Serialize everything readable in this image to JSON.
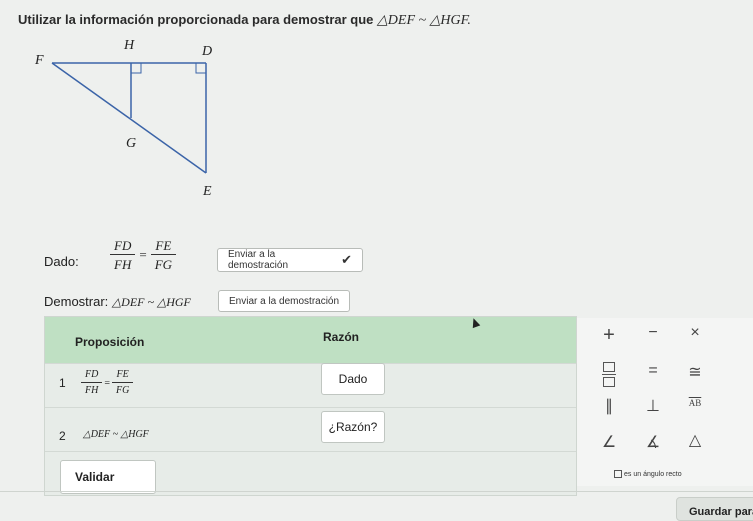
{
  "instruction": {
    "prefix": "Utilizar la información proporcionada para demostrar que",
    "expression": "△DEF ~ △HGF."
  },
  "diagram": {
    "labels": {
      "H": "H",
      "D": "D",
      "F": "F",
      "G": "G",
      "E": "E"
    }
  },
  "given": {
    "label": "Dado:",
    "left_num": "FD",
    "left_den": "FH",
    "equals": "=",
    "right_num": "FE",
    "right_den": "FG",
    "button": "Enviar a la demostración"
  },
  "prove": {
    "label": "Demostrar:",
    "expression": "△DEF ~ △HGF",
    "button": "Enviar a la demostración"
  },
  "table": {
    "header_proposition": "Proposición",
    "header_reason": "Razón",
    "rows": [
      {
        "num": "1",
        "num_top": "FD",
        "num_bot": "FH",
        "eq": "=",
        "num2_top": "FE",
        "num2_bot": "FG",
        "reason": "Dado"
      },
      {
        "num": "2",
        "statement": "△DEF ~ △HGF",
        "reason": "¿Razón?"
      }
    ],
    "validate": "Validar"
  },
  "palette": {
    "symbols": [
      "+",
      "−",
      "×",
      "□/□",
      "=",
      "≅",
      "∥",
      "⊥",
      "AB",
      "∠",
      "∡",
      "△"
    ]
  },
  "note": "es un ángulo recto",
  "save_button": "Guardar para"
}
